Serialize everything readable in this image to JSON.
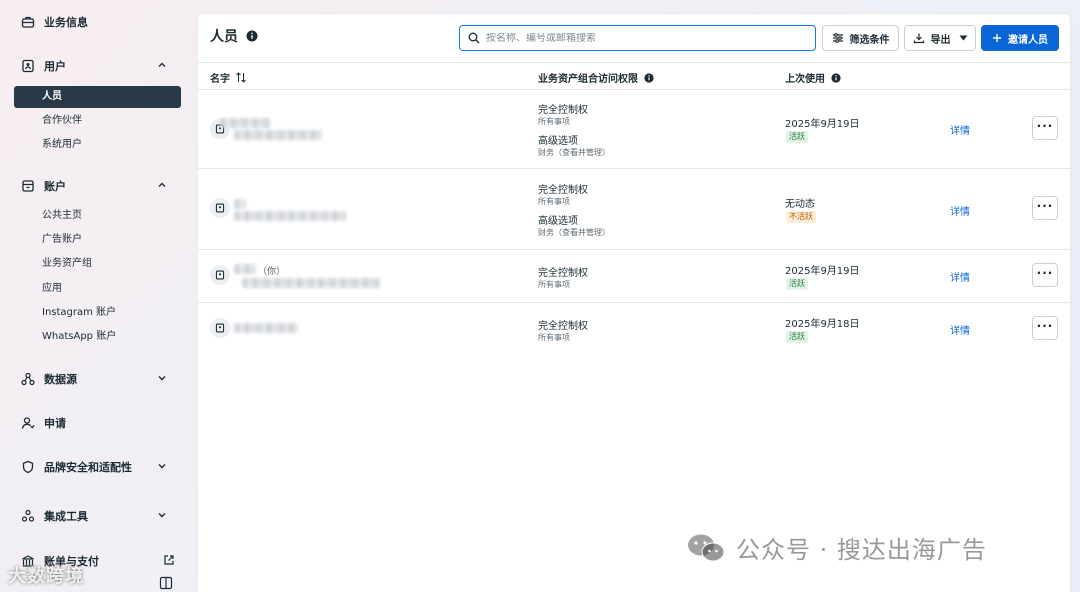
{
  "sidebar": {
    "business_info": "业务信息",
    "users": {
      "label": "用户",
      "items": [
        "人员",
        "合作伙伴",
        "系统用户"
      ],
      "active_index": 0
    },
    "accounts": {
      "label": "账户",
      "items": [
        "公共主页",
        "广告账户",
        "业务资产组",
        "应用",
        "Instagram 账户",
        "WhatsApp 账户"
      ]
    },
    "data_sources": "数据源",
    "requests": "申请",
    "brand_safety": "品牌安全和适配性",
    "integrations": "集成工具",
    "billing": "账单与支付"
  },
  "header": {
    "title": "人员",
    "search_placeholder": "按名称、编号或邮箱搜索",
    "filter_label": "筛选条件",
    "export_label": "导出",
    "invite_label": "邀请人员"
  },
  "table": {
    "columns": {
      "name": "名字",
      "access": "业务资产组合访问权限",
      "last_used": "上次使用"
    },
    "rows": [
      {
        "permissions": [
          {
            "title": "完全控制权",
            "sub": "所有事项"
          },
          {
            "title": "高级选项",
            "sub": "财务（查看并管理）"
          }
        ],
        "last_used": "2025年9月19日",
        "status": "活跃",
        "detail": "详情"
      },
      {
        "permissions": [
          {
            "title": "完全控制权",
            "sub": "所有事项"
          },
          {
            "title": "高级选项",
            "sub": "财务（查看并管理）"
          }
        ],
        "last_used": "无动态",
        "status": "不活跃",
        "detail": "详情"
      },
      {
        "name_suffix": "（你）",
        "permissions": [
          {
            "title": "完全控制权",
            "sub": "所有事项"
          }
        ],
        "last_used": "2025年9月19日",
        "status": "活跃",
        "detail": "详情"
      },
      {
        "permissions": [
          {
            "title": "完全控制权",
            "sub": "所有事项"
          }
        ],
        "last_used": "2025年9月18日",
        "status": "活跃",
        "detail": "详情"
      }
    ]
  },
  "watermarks": {
    "left": "大数跨境",
    "right": "公众号 · 搜达出海广告"
  },
  "colors": {
    "accent": "#0a66d6",
    "active_nav": "#283a48",
    "status_active_bg": "#e3f3e6",
    "status_inactive_bg": "#fdeed9"
  },
  "icons": [
    "briefcase-icon",
    "id-badge-icon",
    "storefront-icon",
    "data-nodes-icon",
    "person-icon",
    "shield-icon",
    "integration-icon",
    "bank-icon",
    "search-icon",
    "filter-icon",
    "download-icon",
    "plus-icon",
    "info-icon",
    "sort-icon",
    "more-icon",
    "external-link-icon",
    "wechat-icon"
  ]
}
